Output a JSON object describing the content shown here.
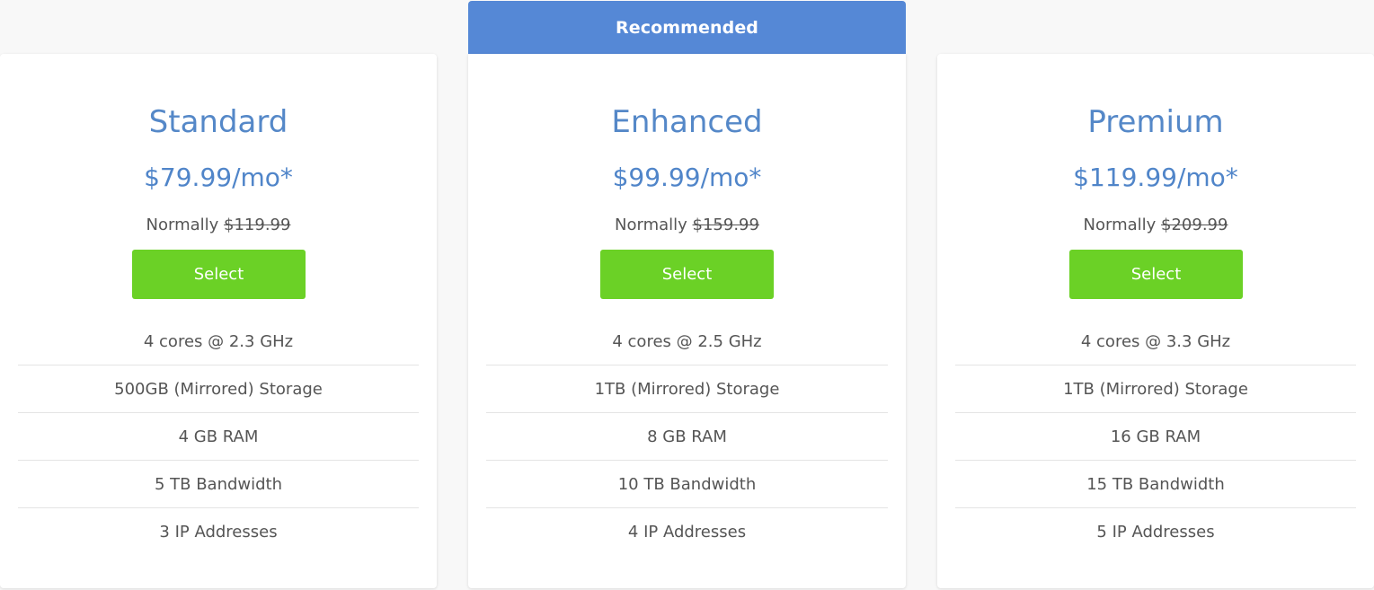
{
  "ribbon": {
    "label": "Recommended"
  },
  "colors": {
    "accent": "#5588d6",
    "button": "#6bd126",
    "title": "#5588c8"
  },
  "plans": [
    {
      "name": "Standard",
      "price": "$79.99/mo*",
      "normally_label": "Normally ",
      "normal_price": "$119.99",
      "button_label": "Select",
      "features": [
        "4 cores @ 2.3 GHz",
        "500GB (Mirrored) Storage",
        "4 GB RAM",
        "5 TB Bandwidth",
        "3 IP Addresses"
      ]
    },
    {
      "name": "Enhanced",
      "price": "$99.99/mo*",
      "normally_label": "Normally ",
      "normal_price": "$159.99",
      "button_label": "Select",
      "features": [
        "4 cores @ 2.5 GHz",
        "1TB (Mirrored) Storage",
        "8 GB RAM",
        "10 TB Bandwidth",
        "4 IP Addresses"
      ]
    },
    {
      "name": "Premium",
      "price": "$119.99/mo*",
      "normally_label": "Normally ",
      "normal_price": "$209.99",
      "button_label": "Select",
      "features": [
        "4 cores @ 3.3 GHz",
        "1TB (Mirrored) Storage",
        "16 GB RAM",
        "15 TB Bandwidth",
        "5 IP Addresses"
      ]
    }
  ]
}
